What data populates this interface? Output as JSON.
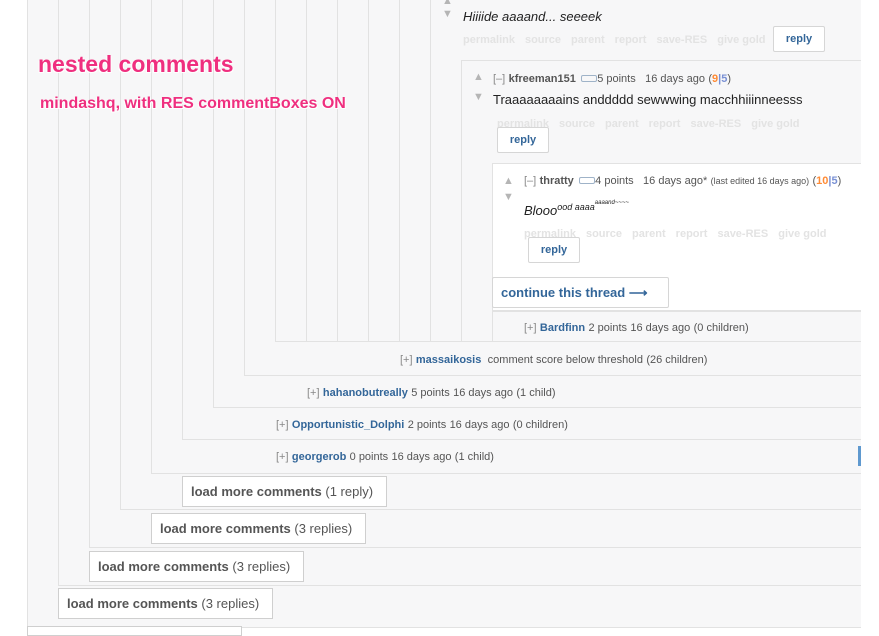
{
  "annotation": {
    "title": "nested comments",
    "subtitle": "mindashq, with RES commentBoxes ON"
  },
  "actions": [
    "permalink",
    "source",
    "parent",
    "report",
    "save-RES",
    "give gold"
  ],
  "reply_label": "reply",
  "comments": {
    "top": {
      "text": "Hiiiide aaaand... seeeek"
    },
    "kfreeman": {
      "toggle": "[–]",
      "author": "kfreeman151",
      "score": "5 points",
      "time": "16 days ago",
      "paren_open": "(",
      "up": "9",
      "sep": "|",
      "down": "5",
      "paren_close": ")",
      "text": "Traaaaaaaains anddddd sewwwing macchhiiinneesss"
    },
    "thratty": {
      "toggle": "[–]",
      "author": "thratty",
      "score": "4 points",
      "time": "16 days ago*",
      "edited": "(last edited 16 days ago)",
      "paren_open": "(",
      "up": "10",
      "sep": "|",
      "down": "5",
      "paren_close": ")",
      "text_main": "Blooo",
      "text_sup": "ood aaaa",
      "text_supsup": "aaaand~~~~"
    }
  },
  "continue_thread": "continue this thread ⟶",
  "collapsed": [
    {
      "toggle": "[+]",
      "author": "Bardfinn",
      "score": "2 points",
      "time": "16 days ago",
      "kids": "(0 children)"
    },
    {
      "toggle": "[+]",
      "author": "massaikosis",
      "score": "comment score below threshold",
      "time": "",
      "kids": "(26 children)"
    },
    {
      "toggle": "[+]",
      "author": "hahanobutreally",
      "score": "5 points",
      "time": "16 days ago",
      "kids": "(1 child)"
    },
    {
      "toggle": "[+]",
      "author": "Opportunistic_Dolphi",
      "score": "2 points",
      "time": "16 days ago",
      "kids": "(0 children)"
    },
    {
      "toggle": "[+]",
      "author": "georgerob",
      "score": "0 points",
      "time": "16 days ago",
      "kids": "(1 child)"
    }
  ],
  "load_more": [
    {
      "label": "load more comments",
      "count": "(1 reply)"
    },
    {
      "label": "load more comments",
      "count": "(3 replies)"
    },
    {
      "label": "load more comments",
      "count": "(3 replies)"
    },
    {
      "label": "load more comments",
      "count": "(3 replies)"
    }
  ],
  "colors": {
    "author": "#336699",
    "annotation": "#ef2f7f",
    "upvotes": "#ff8b35",
    "downvotes": "#7a91d4"
  }
}
